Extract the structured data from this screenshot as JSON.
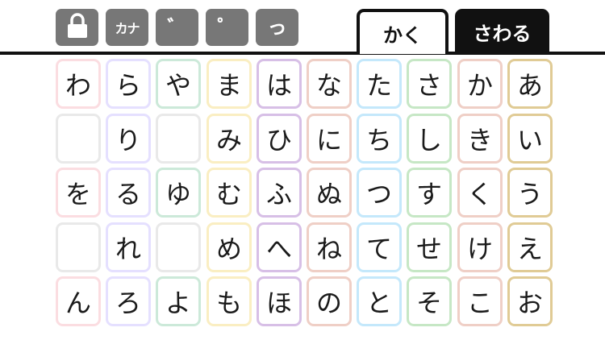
{
  "toolbar": {
    "lock_icon": "lock-icon",
    "katakana_label": "カナ",
    "dakuten_label": "゛",
    "handakuten_label": "゜",
    "small_tsu_label": "っ"
  },
  "tabs": [
    {
      "label": "かく",
      "active": true
    },
    {
      "label": "さわる",
      "active": false
    }
  ],
  "colors": {
    "toolbar_bg": "#777777",
    "tab_active_border": "#111111",
    "column_borders": [
      "#fbdde1",
      "#e5e0ff",
      "#cce9d9",
      "#faeec2",
      "#d7bfe6",
      "#efcfc6",
      "#c4e8fb",
      "#c6e7c5",
      "#efcfc6",
      "#e0cb95"
    ],
    "empty_border": "#e9e9e9"
  },
  "keyboard": {
    "columns": [
      {
        "row": "wa",
        "keys": [
          "わ",
          "",
          "を",
          "",
          "ん"
        ]
      },
      {
        "row": "ra",
        "keys": [
          "ら",
          "り",
          "る",
          "れ",
          "ろ"
        ]
      },
      {
        "row": "ya",
        "keys": [
          "や",
          "",
          "ゆ",
          "",
          "よ"
        ]
      },
      {
        "row": "ma",
        "keys": [
          "ま",
          "み",
          "む",
          "め",
          "も"
        ]
      },
      {
        "row": "ha",
        "keys": [
          "は",
          "ひ",
          "ふ",
          "へ",
          "ほ"
        ]
      },
      {
        "row": "na",
        "keys": [
          "な",
          "に",
          "ぬ",
          "ね",
          "の"
        ]
      },
      {
        "row": "ta",
        "keys": [
          "た",
          "ち",
          "つ",
          "て",
          "と"
        ]
      },
      {
        "row": "sa",
        "keys": [
          "さ",
          "し",
          "す",
          "せ",
          "そ"
        ]
      },
      {
        "row": "ka",
        "keys": [
          "か",
          "き",
          "く",
          "け",
          "こ"
        ]
      },
      {
        "row": "a",
        "keys": [
          "あ",
          "い",
          "う",
          "え",
          "お"
        ]
      }
    ]
  }
}
